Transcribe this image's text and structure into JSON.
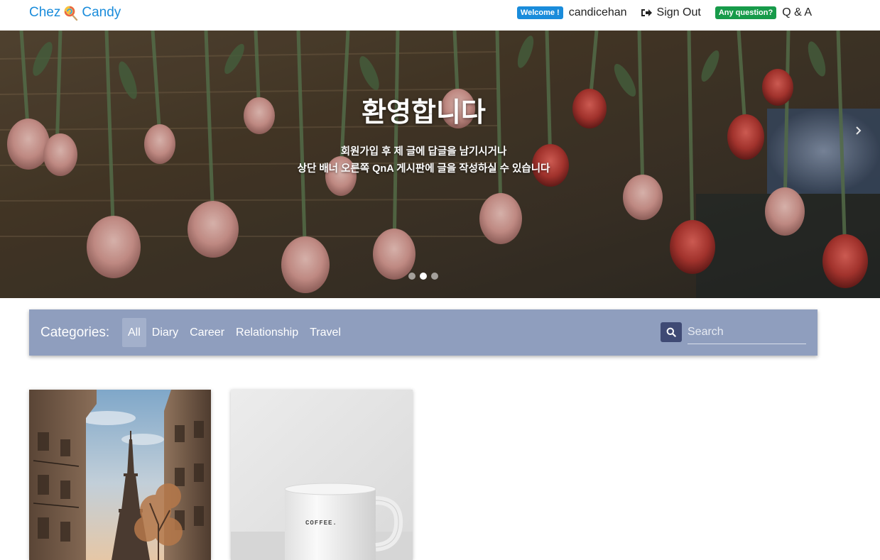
{
  "navbar": {
    "brand_left": "Chez",
    "brand_right": "Candy",
    "brand_icon": "lollipop-icon",
    "welcome_badge": "Welcome !",
    "username": "candicehan",
    "signout_label": "Sign Out",
    "signout_icon": "sign-out-icon",
    "question_badge": "Any question?",
    "qna_label": "Q & A"
  },
  "hero": {
    "title": "환영합니다",
    "subtitle_line1": "회원가입 후 제 글에 답글을 남기시거나",
    "subtitle_line2": "상단 배너 오른쪽 QnA 게시판에 글을 작성하실 수 있습니다",
    "indicator_count": 3,
    "active_slide": 2
  },
  "categories": {
    "label": "Categories:",
    "items": [
      "All",
      "Diary",
      "Career",
      "Relationship",
      "Travel"
    ],
    "active": "All",
    "search_placeholder": "Search"
  },
  "posts": [
    {
      "image": "eiffel-tower-street-photo"
    },
    {
      "image": "coffee-mug-photo",
      "mug_text": "COFFEE."
    }
  ],
  "colors": {
    "brand": "#1a8cdb",
    "welcome_badge": "#1a8cdb",
    "question_badge": "#179b4a",
    "category_bar": "#8f9ebe",
    "search_button": "#3f4a74"
  }
}
